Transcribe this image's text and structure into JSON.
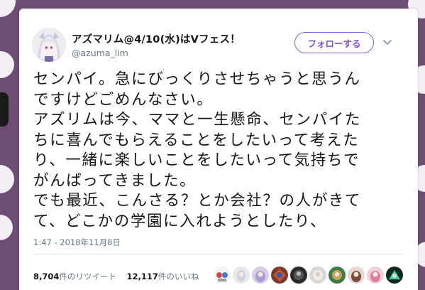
{
  "tweet": {
    "display_name": "アズマリム@4/10(水)はVフェス！",
    "handle": "@azuma_lim",
    "follow_label": "フォローする",
    "text_lines": [
      "センパイ。急にびっくりさせちゃうと思うん",
      "ですけどごめんなさい。",
      "アズリムは今、ママと一生懸命、センパイた",
      "ちに喜んでもらえることをしたいって考えた",
      "り、一緒に楽しいことをしたいって気持ちで",
      "がんばってきました。",
      "でも最近、こんさる？とか会社？の人がきて",
      "て、どこかの学園に入れようとしたり、"
    ],
    "timestamp": "1:47 - 2018年11月8日",
    "retweet_count": "8,704",
    "retweet_label": "件のリツイート",
    "like_count": "12,117",
    "like_label": "件のいいね"
  },
  "colors": {
    "accent": "#7d4fcc",
    "background": "#6e4d75",
    "text": "#14171a",
    "muted": "#657786"
  },
  "icons": [
    "avatar",
    "chevron-down-icon",
    "liker-avatar"
  ]
}
